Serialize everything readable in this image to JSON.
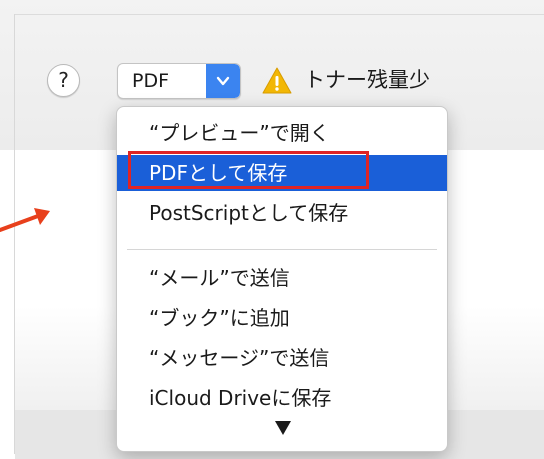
{
  "toolbar": {
    "help_label": "?",
    "format_label": "PDF",
    "warning_text": "トナー残量少"
  },
  "menu": {
    "items": [
      "“プレビュー”で開く",
      "PDFとして保存",
      "PostScriptとして保存",
      "“メール”で送信",
      "“ブック”に追加",
      "“メッセージ”で送信",
      "iCloud Driveに保存"
    ],
    "selected_index": 1
  },
  "colors": {
    "selection": "#1a5fd8",
    "highlight_box": "#e02424",
    "arrow": "#e8401c",
    "warning": "#f2b705"
  },
  "icons": {
    "help": "question-icon",
    "popup": "chevron-down-icon",
    "warning": "warning-triangle-icon",
    "scroll": "scroll-down-triangle-icon",
    "annotation": "red-arrow-icon"
  }
}
